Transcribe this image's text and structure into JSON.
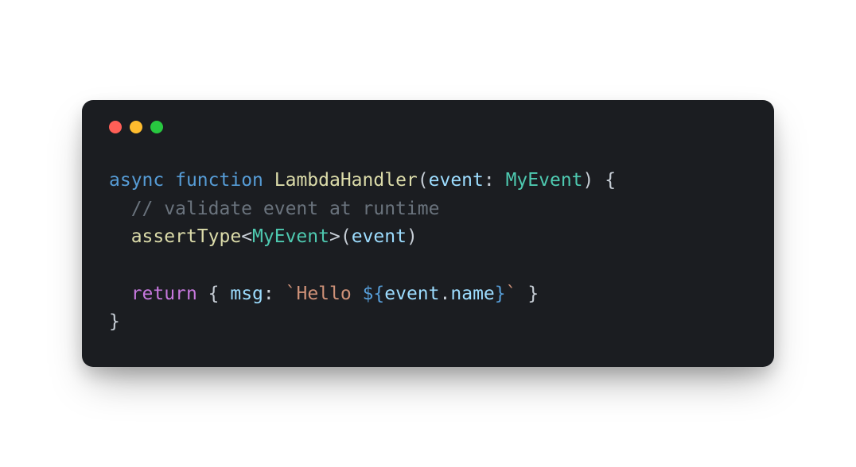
{
  "code": {
    "line1": {
      "kw_async": "async",
      "kw_function": "function",
      "func_name": "LambdaHandler",
      "open_paren": "(",
      "param": "event",
      "colon_sp": ": ",
      "type": "MyEvent",
      "close_paren": ")",
      "sp_brace": " {",
      "brace_open": "{"
    },
    "line2": {
      "indent": "  ",
      "comment": "// validate event at runtime"
    },
    "line3": {
      "indent": "  ",
      "call": "assertType",
      "lt": "<",
      "generic": "MyEvent",
      "gt": ">",
      "open_paren": "(",
      "arg": "event",
      "close_paren": ")"
    },
    "line5": {
      "indent": "  ",
      "kw_return": "return",
      "sp": " ",
      "brace_open": "{ ",
      "prop": "msg",
      "colon_sp": ": ",
      "backtick1": "`",
      "str_text": "Hello ",
      "interp_open": "${",
      "interp_obj": "event",
      "interp_dot": ".",
      "interp_prop": "name",
      "interp_close": "}",
      "backtick2": "`",
      "brace_close": " }"
    },
    "line6": {
      "brace_close": "}"
    }
  }
}
